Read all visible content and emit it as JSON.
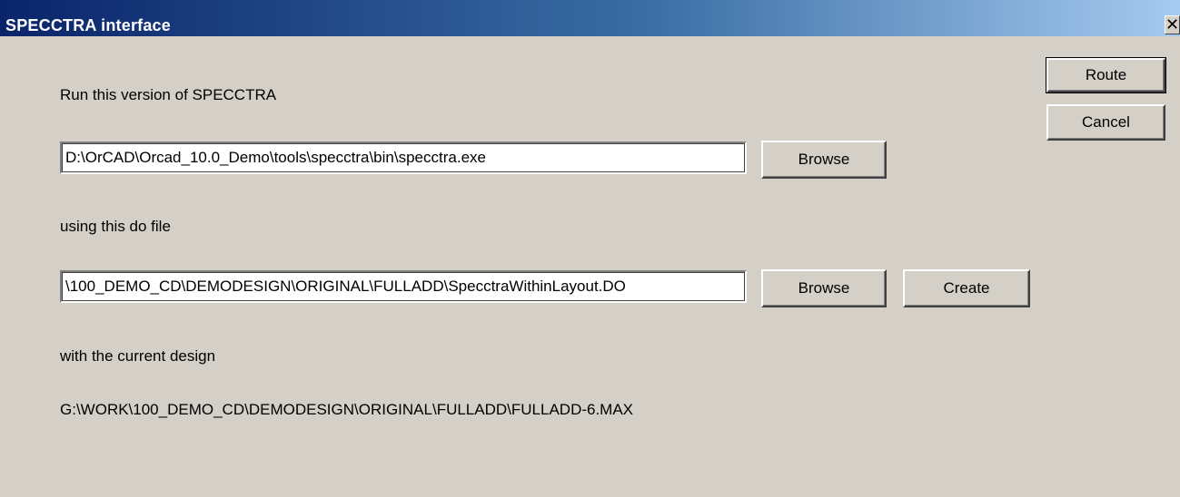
{
  "window": {
    "title": "SPECCTRA interface",
    "close_glyph": "✕"
  },
  "version": {
    "label": "Run this version of SPECCTRA",
    "path_value": "D:\\OrCAD\\Orcad_10.0_Demo\\tools\\specctra\\bin\\specctra.exe",
    "browse_label": "Browse"
  },
  "dofile": {
    "label": "using this do file",
    "path_value": "\\100_DEMO_CD\\DEMODESIGN\\ORIGINAL\\FULLADD\\SpecctraWithinLayout.DO",
    "browse_label": "Browse",
    "create_label": "Create"
  },
  "design": {
    "label": "with the current design",
    "path": "G:\\WORK\\100_DEMO_CD\\DEMODESIGN\\ORIGINAL\\FULLADD\\FULLADD-6.MAX"
  },
  "actions": {
    "route_label": "Route",
    "cancel_label": "Cancel"
  }
}
